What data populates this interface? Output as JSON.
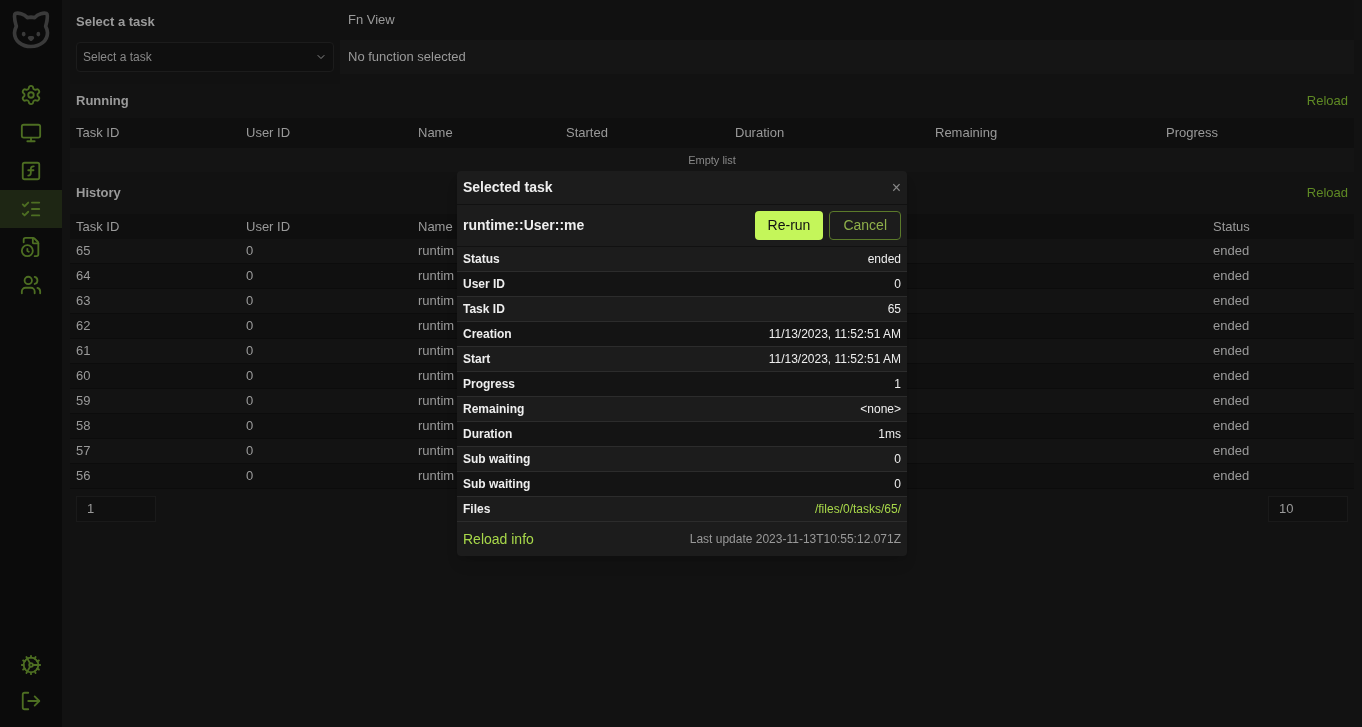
{
  "sidebar": {
    "items": [
      {
        "selected": false
      },
      {
        "selected": false
      },
      {
        "selected": false
      },
      {
        "selected": true
      },
      {
        "selected": false
      },
      {
        "selected": false
      }
    ]
  },
  "task_picker": {
    "title": "Select a task",
    "placeholder": "Select a task"
  },
  "function_view": {
    "title": "Fn View",
    "message": "No function selected"
  },
  "running": {
    "title": "Running",
    "reload": "Reload",
    "columns": [
      "Task ID",
      "User ID",
      "Name",
      "Started",
      "Duration",
      "Remaining",
      "Progress"
    ],
    "empty": "Empty list"
  },
  "history": {
    "title": "History",
    "reload": "Reload",
    "columns": [
      "Task ID",
      "User ID",
      "Name",
      "Status"
    ],
    "rows": [
      {
        "task_id": "65",
        "user_id": "0",
        "name": "runtim",
        "status": "ended"
      },
      {
        "task_id": "64",
        "user_id": "0",
        "name": "runtim",
        "status": "ended"
      },
      {
        "task_id": "63",
        "user_id": "0",
        "name": "runtim",
        "status": "ended"
      },
      {
        "task_id": "62",
        "user_id": "0",
        "name": "runtim",
        "status": "ended"
      },
      {
        "task_id": "61",
        "user_id": "0",
        "name": "runtim",
        "status": "ended"
      },
      {
        "task_id": "60",
        "user_id": "0",
        "name": "runtim",
        "status": "ended"
      },
      {
        "task_id": "59",
        "user_id": "0",
        "name": "runtim",
        "status": "ended"
      },
      {
        "task_id": "58",
        "user_id": "0",
        "name": "runtim",
        "status": "ended"
      },
      {
        "task_id": "57",
        "user_id": "0",
        "name": "runtim",
        "status": "ended"
      },
      {
        "task_id": "56",
        "user_id": "0",
        "name": "runtim",
        "status": "ended"
      }
    ],
    "page": "1",
    "page_size": "10"
  },
  "dialog": {
    "title": "Selected task",
    "close": "×",
    "task_name": "runtime::User::me",
    "buttons": [
      {
        "label": "Re-run",
        "kind": "primary"
      },
      {
        "label": "Cancel",
        "kind": "outline"
      }
    ],
    "fields": [
      {
        "label": "Status",
        "value": "ended",
        "kind": "text"
      },
      {
        "label": "User ID",
        "value": "0",
        "kind": "text"
      },
      {
        "label": "Task ID",
        "value": "65",
        "kind": "text"
      },
      {
        "label": "Creation",
        "value": "11/13/2023, 11:52:51 AM",
        "kind": "text"
      },
      {
        "label": "Start",
        "value": "11/13/2023, 11:52:51 AM",
        "kind": "text"
      },
      {
        "label": "Progress",
        "value": "1",
        "kind": "text"
      },
      {
        "label": "Remaining",
        "value": "<none>",
        "kind": "text"
      },
      {
        "label": "Duration",
        "value": "1ms",
        "kind": "text"
      },
      {
        "label": "Sub waiting",
        "value": "0",
        "kind": "text"
      },
      {
        "label": "Sub waiting",
        "value": "0",
        "kind": "text"
      },
      {
        "label": "Files",
        "value": "/files/0/tasks/65/",
        "kind": "link"
      }
    ],
    "reload": "Reload info",
    "last_update": "Last update 2023-11-13T10:55:12.071Z"
  }
}
